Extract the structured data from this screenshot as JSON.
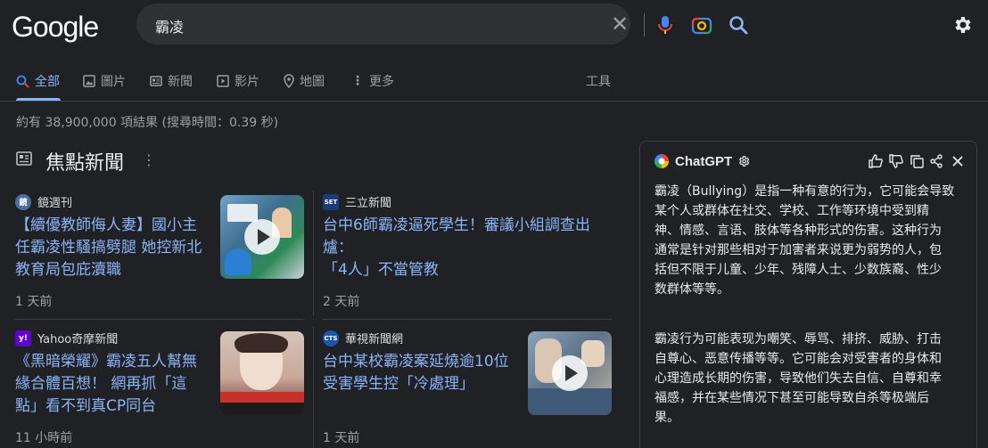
{
  "header": {
    "logo": "Google",
    "search_query": "霸凌"
  },
  "tabs": [
    {
      "label": "全部",
      "icon": "search-icon"
    },
    {
      "label": "圖片",
      "icon": "image-icon"
    },
    {
      "label": "新聞",
      "icon": "news-icon"
    },
    {
      "label": "影片",
      "icon": "video-icon"
    },
    {
      "label": "地圖",
      "icon": "map-pin-icon"
    },
    {
      "label": "更多",
      "icon": "more-vert-icon"
    }
  ],
  "tools_label": "工具",
  "result_stats": "約有 38,900,000 項結果 (搜尋時間：0.39 秒)",
  "top_stories": {
    "title": "焦點新聞",
    "items": [
      {
        "source": "鏡週刊",
        "headline_lines": [
          "【續優教師侮人妻】國小主",
          "任霸凌性騷搞劈腿 她控新北",
          "教育局包庇瀆職"
        ],
        "time": "1 天前",
        "has_video": true
      },
      {
        "source": "三立新聞",
        "headline_lines": [
          "台中6師霸凌逼死學生！審議小組調查出爐：",
          "「4人」不當管教"
        ],
        "time": "2 天前",
        "has_video": false
      },
      {
        "source": "Yahoo奇摩新聞",
        "headline_lines": [
          "《黑暗榮耀》霸凌五人幫無",
          "緣合體百想！ 網再抓「這",
          "點」看不到真CP同台"
        ],
        "time": "11 小時前",
        "has_video": false
      },
      {
        "source": "華視新聞網",
        "headline_lines": [
          "台中某校霸凌案延燒逾10位",
          "受害學生控「冷處理」"
        ],
        "time": "1 天前",
        "has_video": true
      }
    ]
  },
  "chatgpt": {
    "name": "ChatGPT",
    "para1": [
      "霸凌（Bullying）是指一种有意的行为，它可能会导致",
      "某个人或群体在社交、学校、工作等环境中受到精",
      "神、情感、言语、肢体等各种形式的伤害。这种行为",
      "通常是针对那些相对于加害者来说更为弱势的人，包",
      "括但不限于儿童、少年、残障人士、少数族裔、性少",
      "数群体等等。"
    ],
    "para2": [
      "霸凌行为可能表现为嘲笑、辱骂、排挤、威胁、打击",
      "自尊心、恶意传播等等。它可能会对受害者的身体和",
      "心理造成长期的伤害，导致他们失去自信、自尊和幸",
      "福感，并在某些情况下甚至可能导致自杀等极端后",
      "果。"
    ]
  },
  "colors": {
    "link": "#8ab4f8",
    "background": "#202124",
    "search_bar": "#303134"
  }
}
